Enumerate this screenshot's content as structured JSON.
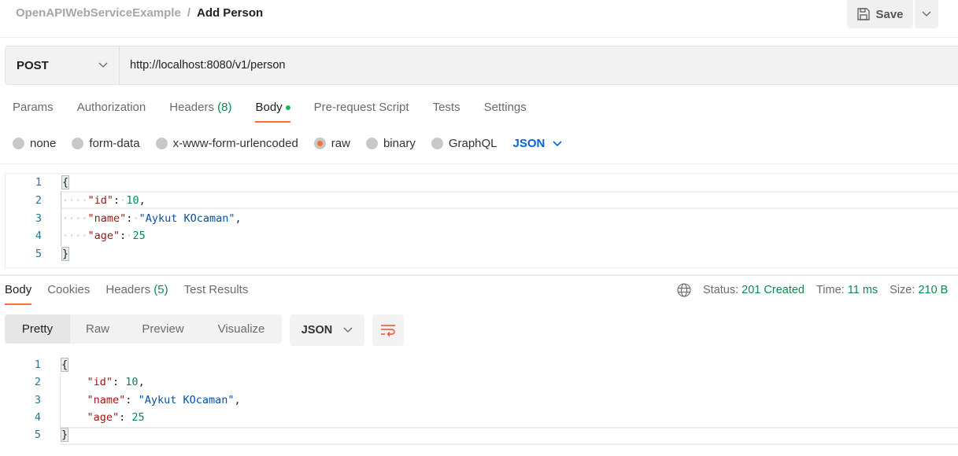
{
  "header": {
    "collection": "OpenAPIWebServiceExample",
    "separator": "/",
    "request_name": "Add Person",
    "save_label": "Save"
  },
  "request": {
    "method": "POST",
    "url": "http://localhost:8080/v1/person"
  },
  "request_tabs": [
    {
      "label": "Params"
    },
    {
      "label": "Authorization"
    },
    {
      "label": "Headers",
      "count": "(8)"
    },
    {
      "label": "Body"
    },
    {
      "label": "Pre-request Script"
    },
    {
      "label": "Tests"
    },
    {
      "label": "Settings"
    }
  ],
  "body_types": [
    "none",
    "form-data",
    "x-www-form-urlencoded",
    "raw",
    "binary",
    "GraphQL"
  ],
  "body_selected": "raw",
  "body_language": "JSON",
  "request_body": {
    "line_numbers": [
      "1",
      "2",
      "3",
      "4",
      "5"
    ],
    "open": "{",
    "close": "}",
    "id_key": "\"id\"",
    "id_val": "10",
    "name_key": "\"name\"",
    "name_val": "\"Aykut KOcaman\"",
    "age_key": "\"age\"",
    "age_val": "25"
  },
  "response_tabs": [
    {
      "label": "Body"
    },
    {
      "label": "Cookies"
    },
    {
      "label": "Headers",
      "count": "(5)"
    },
    {
      "label": "Test Results"
    }
  ],
  "response_status": {
    "status_label": "Status:",
    "status": "201 Created",
    "time_label": "Time:",
    "time": "11 ms",
    "size_label": "Size:",
    "size": "210 B"
  },
  "view_modes": [
    "Pretty",
    "Raw",
    "Preview",
    "Visualize"
  ],
  "response_language": "JSON",
  "colors": {
    "accent": "#ff6c37",
    "success": "#0a8a4c",
    "link": "#0265d2"
  }
}
